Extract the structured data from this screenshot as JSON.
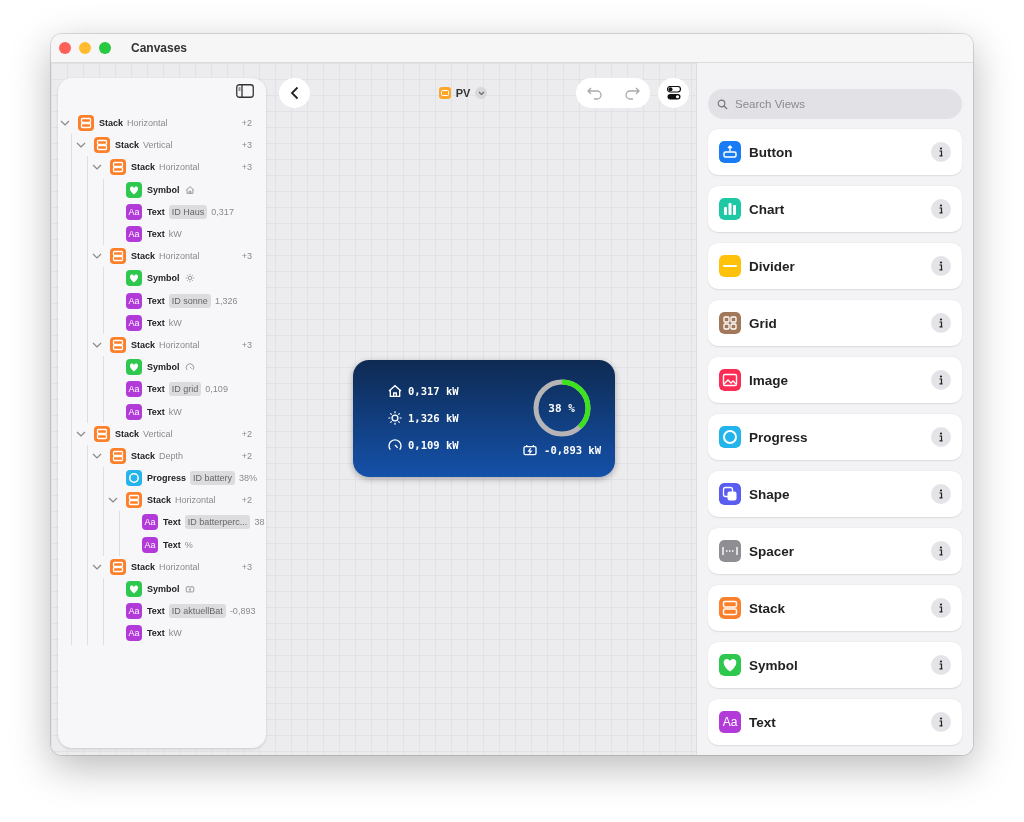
{
  "window": {
    "title": "Canvases"
  },
  "toolbar": {
    "canvas_name": "PV"
  },
  "tree": [
    {
      "kind": "stack",
      "name": "Stack",
      "detail": "Horizontal",
      "count": "+2",
      "expanded": true,
      "children": [
        {
          "kind": "stack",
          "name": "Stack",
          "detail": "Vertical",
          "count": "+3",
          "expanded": true,
          "children": [
            {
              "kind": "stack",
              "name": "Stack",
              "detail": "Horizontal",
              "count": "+3",
              "expanded": true,
              "children": [
                {
                  "kind": "symbol",
                  "name": "Symbol"
                },
                {
                  "kind": "text",
                  "badge": "Aa",
                  "name": "Text",
                  "id": "ID Haus",
                  "value": "0,317"
                },
                {
                  "kind": "text",
                  "badge": "Aa",
                  "name": "Text",
                  "value": "kW"
                }
              ]
            },
            {
              "kind": "stack",
              "name": "Stack",
              "detail": "Horizontal",
              "count": "+3",
              "expanded": true,
              "children": [
                {
                  "kind": "symbol",
                  "name": "Symbol"
                },
                {
                  "kind": "text",
                  "badge": "Aa",
                  "name": "Text",
                  "id": "ID sonne",
                  "value": "1,326"
                },
                {
                  "kind": "text",
                  "badge": "Aa",
                  "name": "Text",
                  "value": "kW"
                }
              ]
            },
            {
              "kind": "stack",
              "name": "Stack",
              "detail": "Horizontal",
              "count": "+3",
              "expanded": true,
              "children": [
                {
                  "kind": "symbol",
                  "name": "Symbol"
                },
                {
                  "kind": "text",
                  "badge": "Aa",
                  "name": "Text",
                  "id": "ID grid",
                  "value": "0,109"
                },
                {
                  "kind": "text",
                  "badge": "Aa",
                  "name": "Text",
                  "value": "kW"
                }
              ]
            }
          ]
        },
        {
          "kind": "stack",
          "name": "Stack",
          "detail": "Vertical",
          "count": "+2",
          "expanded": true,
          "children": [
            {
              "kind": "stack",
              "name": "Stack",
              "detail": "Depth",
              "count": "+2",
              "expanded": true,
              "children": [
                {
                  "kind": "progress",
                  "name": "Progress",
                  "id": "ID battery",
                  "value": "38%"
                },
                {
                  "kind": "stack",
                  "name": "Stack",
                  "detail": "Horizontal",
                  "count": "+2",
                  "expanded": true,
                  "children": [
                    {
                      "kind": "text",
                      "badge": "Aa",
                      "name": "Text",
                      "id": "ID batterperc...",
                      "value": "38"
                    },
                    {
                      "kind": "text",
                      "badge": "Aa",
                      "name": "Text",
                      "value": "%"
                    }
                  ]
                }
              ]
            },
            {
              "kind": "stack",
              "name": "Stack",
              "detail": "Horizontal",
              "count": "+3",
              "expanded": true,
              "children": [
                {
                  "kind": "symbol",
                  "name": "Symbol"
                },
                {
                  "kind": "text",
                  "badge": "Aa",
                  "name": "Text",
                  "id": "ID aktuellBat",
                  "value": "-0,893"
                },
                {
                  "kind": "text",
                  "badge": "Aa",
                  "name": "Text",
                  "value": "kW"
                }
              ]
            }
          ]
        }
      ]
    }
  ],
  "widget": {
    "rows": [
      {
        "text": "0,317 kW"
      },
      {
        "text": "1,326 kW"
      },
      {
        "text": "0,109 kW"
      }
    ],
    "ring": {
      "level": 0.38,
      "label": "38 %"
    },
    "battery": "-0,893 kW"
  },
  "views": {
    "search": {
      "placeholder": "Search Views"
    },
    "items": [
      {
        "kind": "button",
        "label": "Button",
        "color": "#1a7cf5"
      },
      {
        "kind": "chart",
        "label": "Chart",
        "color": "#1ec8a5"
      },
      {
        "kind": "divider",
        "label": "Divider",
        "color": "#ffc20a"
      },
      {
        "kind": "grid",
        "label": "Grid",
        "color": "#a2785a"
      },
      {
        "kind": "image",
        "label": "Image",
        "color": "#fb2d55"
      },
      {
        "kind": "progress",
        "label": "Progress",
        "color": "#22b4ea"
      },
      {
        "kind": "shape",
        "label": "Shape",
        "color": "#5b5cf0"
      },
      {
        "kind": "spacer",
        "label": "Spacer",
        "color": "#8e8e93"
      },
      {
        "kind": "stack",
        "label": "Stack",
        "color": "#fc7f2a"
      },
      {
        "kind": "symbol",
        "label": "Symbol",
        "color": "#2fc84f"
      },
      {
        "kind": "text",
        "label": "Text",
        "badge": "Aa",
        "color": "#b13ad8"
      }
    ]
  }
}
